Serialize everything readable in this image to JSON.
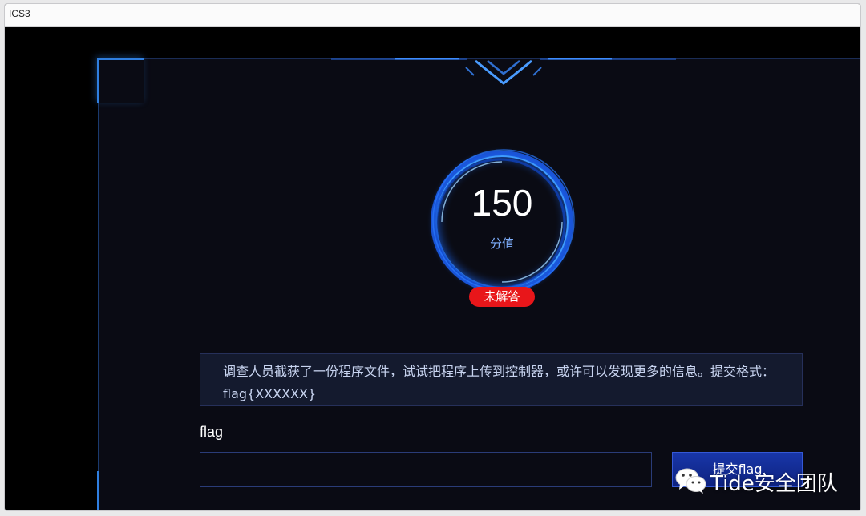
{
  "window": {
    "title": "ICS3"
  },
  "challenge": {
    "score": "150",
    "score_label": "分值",
    "status": "未解答",
    "description": "调查人员截获了一份程序文件，试试把程序上传到控制器，或许可以发现更多的信息。提交格式：flag{XXXXXX}"
  },
  "form": {
    "flag_label": "flag",
    "flag_value": "",
    "submit_label": "提交flag"
  },
  "watermark": {
    "text": "Tide安全团队",
    "icon": "wechat-icon"
  },
  "colors": {
    "accent": "#2f7fe0",
    "status_badge": "#e8161a",
    "panel_bg": "#0a0b14",
    "button": "#1836a8"
  }
}
